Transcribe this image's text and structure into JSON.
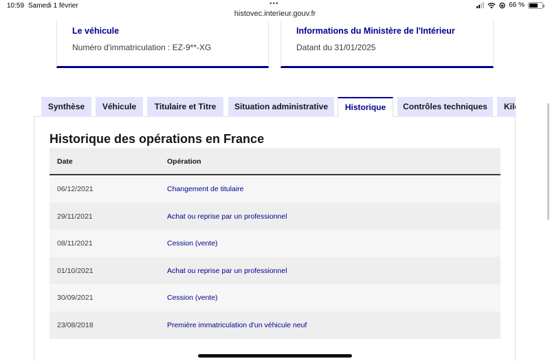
{
  "status_bar": {
    "time": "10:59",
    "date": "Samedi 1 février",
    "battery": "66 %",
    "battery_level": 0.66,
    "url": "histovec.interieur.gouv.fr"
  },
  "cards": [
    {
      "title": "Le véhicule",
      "text": "Numéro d'immatriculation : EZ-9**-XG"
    },
    {
      "title": "Informations du Ministère de l'Intérieur",
      "text": "Datant du 31/01/2025"
    }
  ],
  "tabs": [
    {
      "label": "Synthèse",
      "active": false
    },
    {
      "label": "Véhicule",
      "active": false
    },
    {
      "label": "Titulaire et Titre",
      "active": false
    },
    {
      "label": "Situation administrative",
      "active": false
    },
    {
      "label": "Historique",
      "active": true
    },
    {
      "label": "Contrôles techniques",
      "active": false
    },
    {
      "label": "Kilo",
      "active": false
    }
  ],
  "history": {
    "title": "Historique des opérations en France",
    "columns": {
      "date": "Date",
      "operation": "Opération"
    },
    "rows": [
      {
        "date": "06/12/2021",
        "operation": "Changement de titulaire"
      },
      {
        "date": "29/11/2021",
        "operation": "Achat ou reprise par un professionnel"
      },
      {
        "date": "08/11/2021",
        "operation": "Cession (vente)"
      },
      {
        "date": "01/10/2021",
        "operation": "Achat ou reprise par un professionnel"
      },
      {
        "date": "30/09/2021",
        "operation": "Cession (vente)"
      },
      {
        "date": "23/08/2018",
        "operation": "Première immatriculation d'un véhicule neuf"
      }
    ]
  },
  "colors": {
    "accent": "#000091",
    "tab_background": "#e3e3fd",
    "row_light": "#f6f6f6",
    "row_dark": "#eeeeee"
  }
}
